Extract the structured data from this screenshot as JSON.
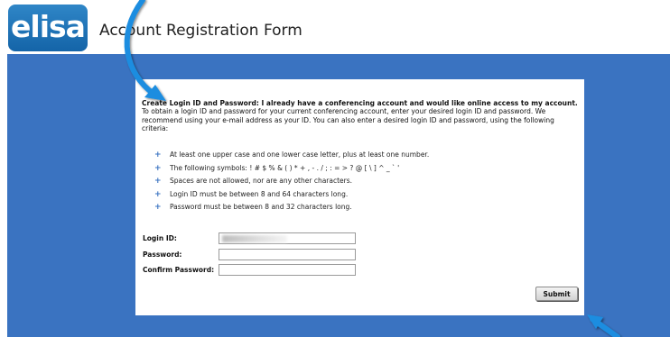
{
  "header": {
    "logo_text": "elisa",
    "title": "Account Registration Form"
  },
  "intro": {
    "heading": "Create Login ID and Password: I already have a conferencing account and would like online access to my account.",
    "body": "To obtain a login ID and password for your current conferencing account, enter your desired login ID and password. We recommend using your e-mail address as your ID. You can also enter a desired login ID and password, using the following criteria:"
  },
  "rules": [
    "At least one upper case and one lower case letter, plus at least one number.",
    "The following symbols: ! # $ % & ( ) * + , - . / ; : = > ? @ [ \\ ] ^ _ ` '",
    "Spaces are not allowed, nor are any other characters.",
    "Login ID must be between 8 and 64 characters long.",
    "Password must be between 8 and 32 characters long."
  ],
  "bullet_icon": "plus-icon",
  "form": {
    "login_label": "Login ID:",
    "password_label": "Password:",
    "confirm_label": "Confirm Password:",
    "password_value": "",
    "confirm_value": ""
  },
  "submit_label": "Submit",
  "colors": {
    "background_blue": "#3a73c1",
    "arrow_blue": "#1a8de0",
    "logo_blue": "#1e74b8"
  },
  "annotations": [
    "arrow-icon",
    "arrow-icon"
  ]
}
